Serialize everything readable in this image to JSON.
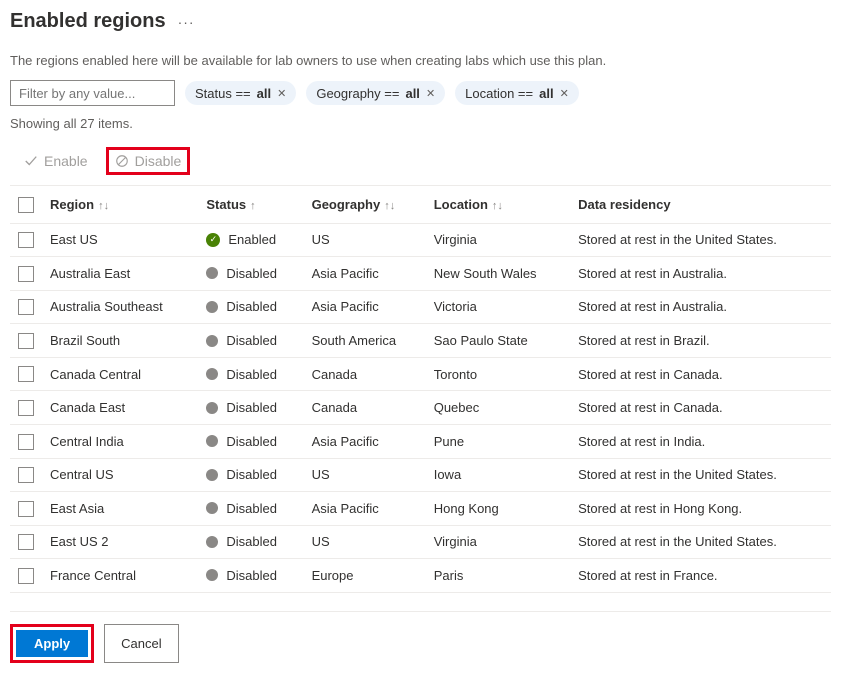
{
  "header": {
    "title": "Enabled regions"
  },
  "description": "The regions enabled here will be available for lab owners to use when creating labs which use this plan.",
  "filter": {
    "placeholder": "Filter by any value..."
  },
  "pills": [
    {
      "label": "Status == ",
      "value": "all"
    },
    {
      "label": "Geography == ",
      "value": "all"
    },
    {
      "label": "Location == ",
      "value": "all"
    }
  ],
  "count_text": "Showing all 27 items.",
  "actions": {
    "enable": "Enable",
    "disable": "Disable"
  },
  "columns": {
    "region": "Region",
    "status": "Status",
    "geography": "Geography",
    "location": "Location",
    "data_residency": "Data residency"
  },
  "rows": [
    {
      "region": "East US",
      "status": "Enabled",
      "enabled": true,
      "geography": "US",
      "location": "Virginia",
      "data_residency": "Stored at rest in the United States."
    },
    {
      "region": "Australia East",
      "status": "Disabled",
      "enabled": false,
      "geography": "Asia Pacific",
      "location": "New South Wales",
      "data_residency": "Stored at rest in Australia."
    },
    {
      "region": "Australia Southeast",
      "status": "Disabled",
      "enabled": false,
      "geography": "Asia Pacific",
      "location": "Victoria",
      "data_residency": "Stored at rest in Australia."
    },
    {
      "region": "Brazil South",
      "status": "Disabled",
      "enabled": false,
      "geography": "South America",
      "location": "Sao Paulo State",
      "data_residency": "Stored at rest in Brazil."
    },
    {
      "region": "Canada Central",
      "status": "Disabled",
      "enabled": false,
      "geography": "Canada",
      "location": "Toronto",
      "data_residency": "Stored at rest in Canada."
    },
    {
      "region": "Canada East",
      "status": "Disabled",
      "enabled": false,
      "geography": "Canada",
      "location": "Quebec",
      "data_residency": "Stored at rest in Canada."
    },
    {
      "region": "Central India",
      "status": "Disabled",
      "enabled": false,
      "geography": "Asia Pacific",
      "location": "Pune",
      "data_residency": "Stored at rest in India."
    },
    {
      "region": "Central US",
      "status": "Disabled",
      "enabled": false,
      "geography": "US",
      "location": "Iowa",
      "data_residency": "Stored at rest in the United States."
    },
    {
      "region": "East Asia",
      "status": "Disabled",
      "enabled": false,
      "geography": "Asia Pacific",
      "location": "Hong Kong",
      "data_residency": "Stored at rest in Hong Kong."
    },
    {
      "region": "East US 2",
      "status": "Disabled",
      "enabled": false,
      "geography": "US",
      "location": "Virginia",
      "data_residency": "Stored at rest in the United States."
    },
    {
      "region": "France Central",
      "status": "Disabled",
      "enabled": false,
      "geography": "Europe",
      "location": "Paris",
      "data_residency": "Stored at rest in France."
    }
  ],
  "footer": {
    "apply": "Apply",
    "cancel": "Cancel"
  }
}
